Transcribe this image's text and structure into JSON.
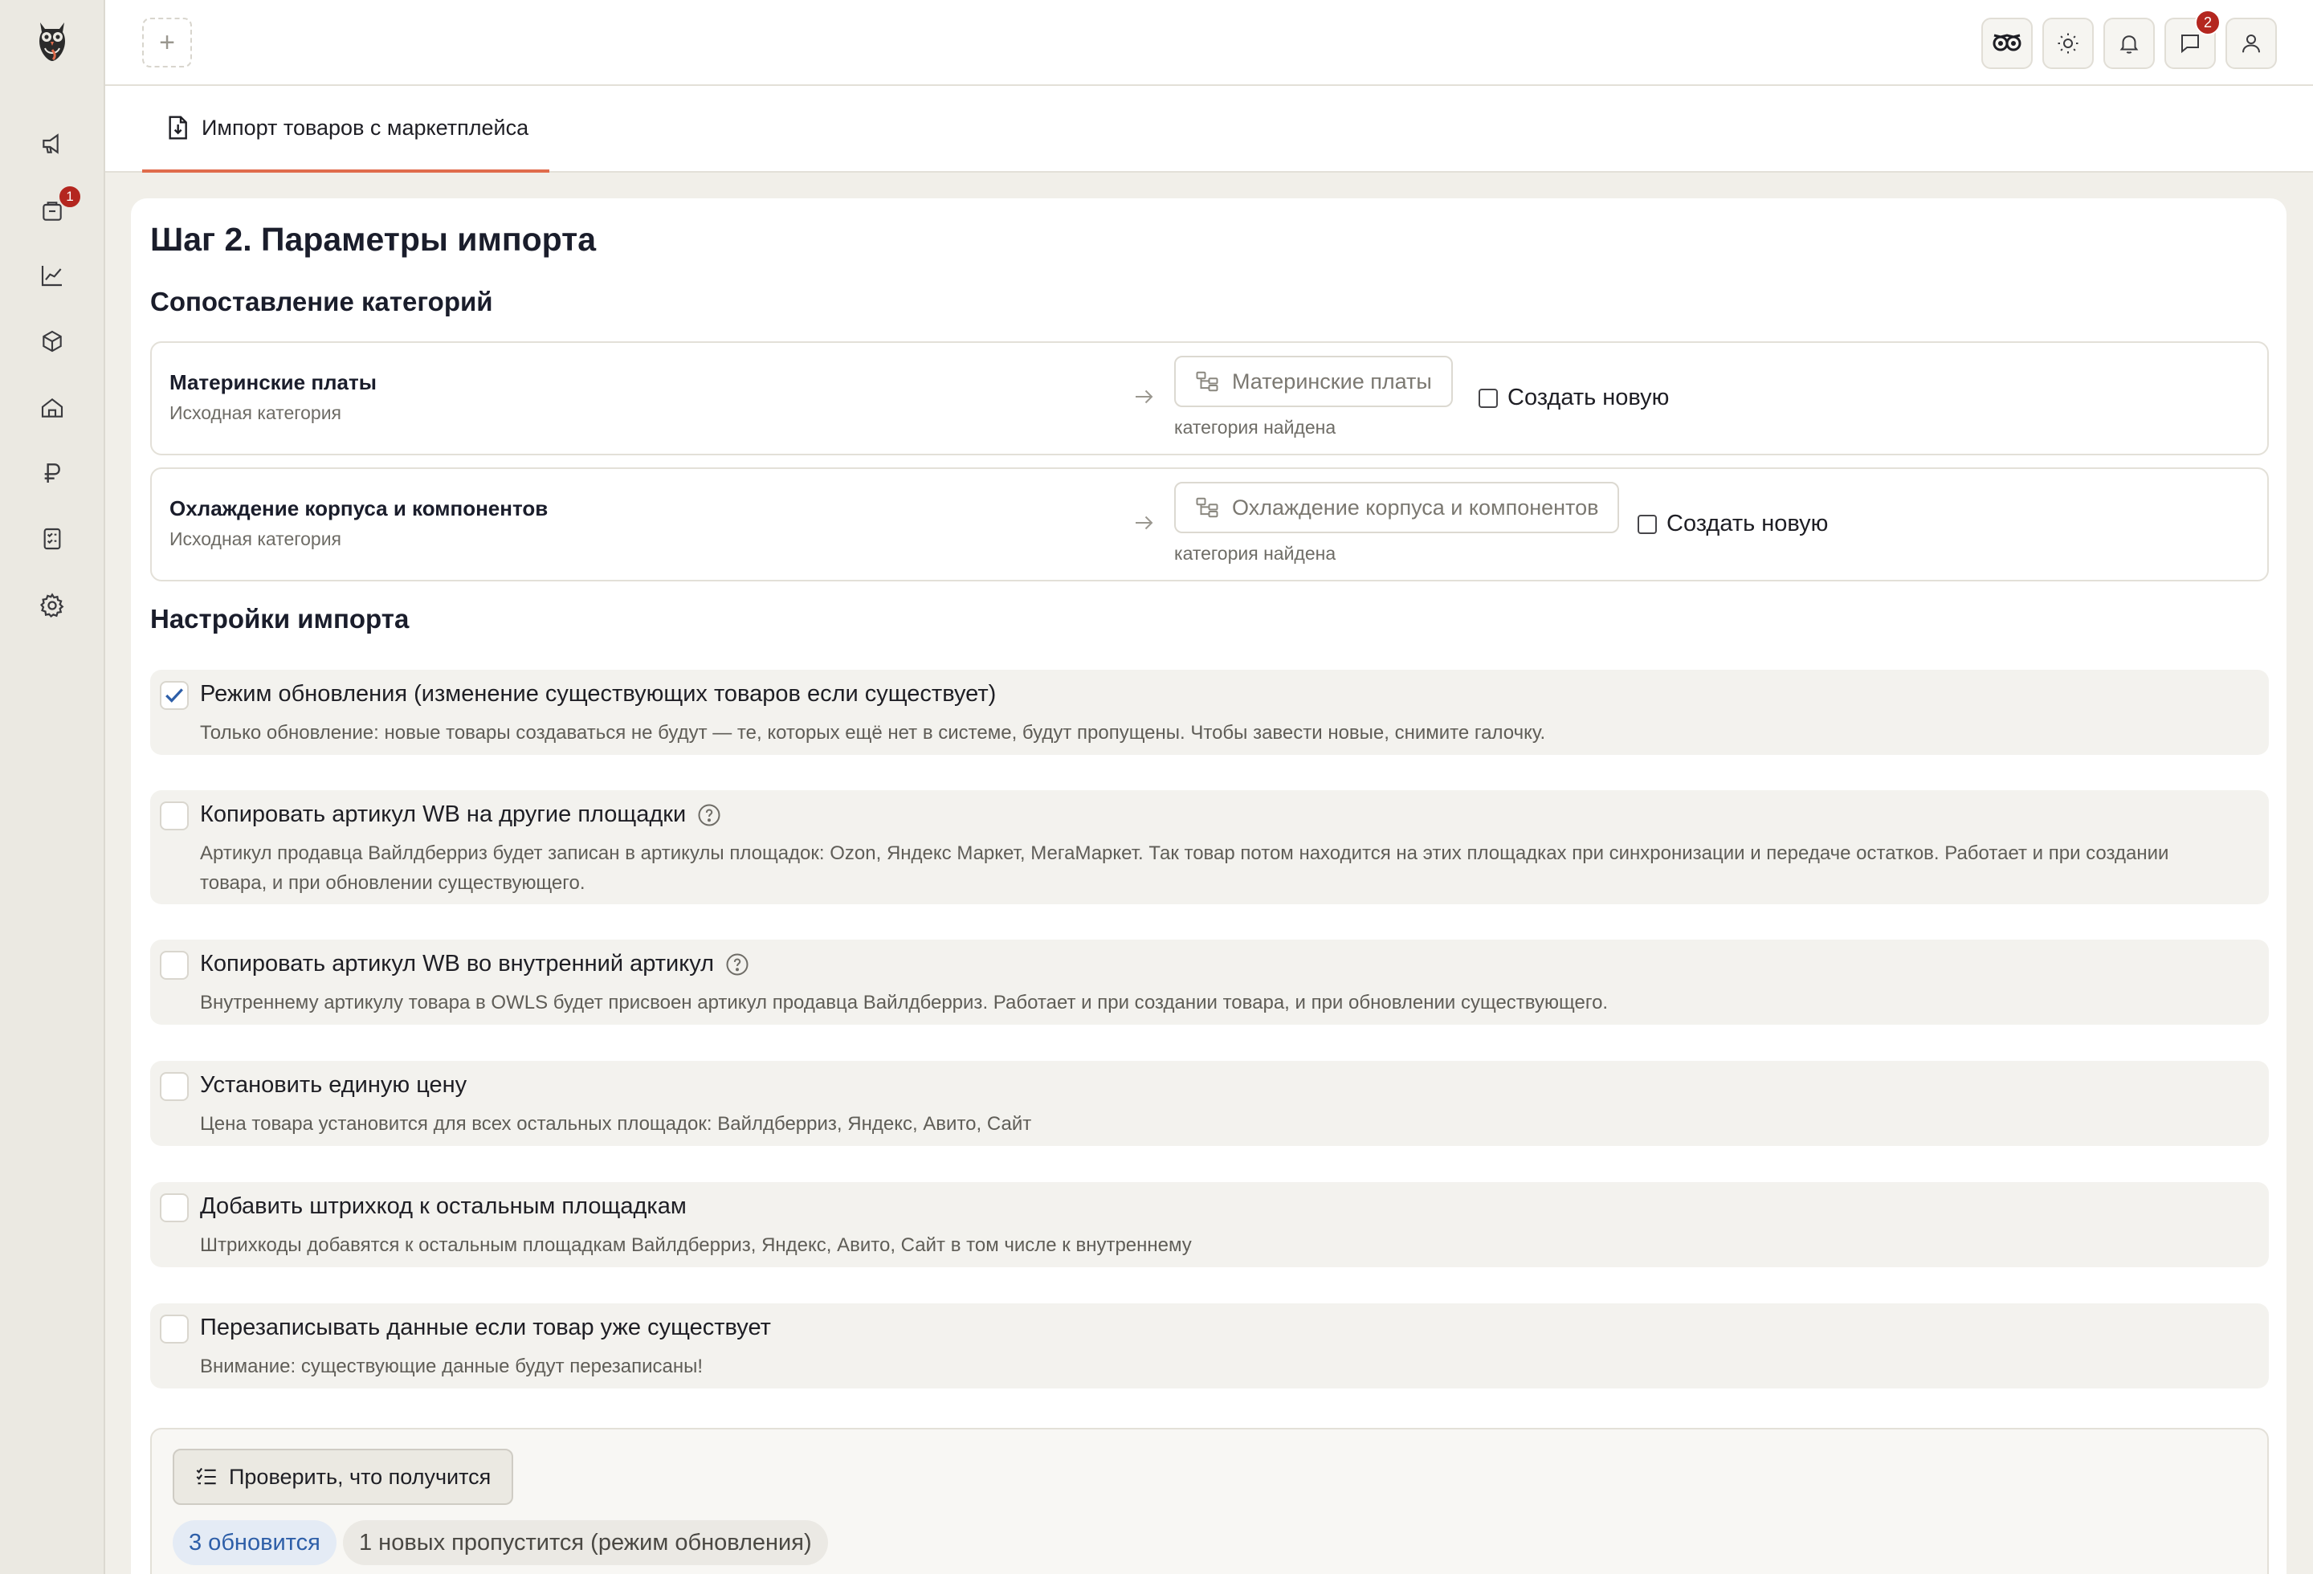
{
  "sidebar": {
    "logo_name": "owl-logo",
    "items": [
      {
        "name": "megaphone-icon"
      },
      {
        "name": "orders-icon",
        "badge": "1"
      },
      {
        "name": "analytics-icon"
      },
      {
        "name": "cube-icon"
      },
      {
        "name": "home-icon"
      },
      {
        "name": "ruble-icon"
      },
      {
        "name": "checklist-icon"
      },
      {
        "name": "settings-icon"
      }
    ]
  },
  "topbar": {
    "add_tab_label": "+",
    "messages_badge": "2"
  },
  "tab": {
    "label": "Импорт товаров с маркетплейса"
  },
  "page": {
    "title": "Шаг 2. Параметры импорта",
    "mapping_heading": "Сопоставление категорий",
    "settings_heading": "Настройки импорта"
  },
  "mappings": [
    {
      "source": "Материнские платы",
      "source_sub": "Исходная категория",
      "target": "Материнские платы",
      "status": "категория найдена",
      "create_label": "Создать новую"
    },
    {
      "source": "Охлаждение корпуса и компонентов",
      "source_sub": "Исходная категория",
      "target": "Охлаждение корпуса и компонентов",
      "status": "категория найдена",
      "create_label": "Создать новую"
    }
  ],
  "options": [
    {
      "title": "Режим обновления (изменение существующих товаров если существует)",
      "desc": "Только обновление: новые товары создаваться не будут — те, которых ещё нет в системе, будут пропущены. Чтобы завести новые, снимите галочку.",
      "checked": true
    },
    {
      "title": "Копировать артикул WB на другие площадки",
      "desc": "Артикул продавца Вайлдберриз будет записан в артикулы площадок: Ozon, Яндекс Маркет, МегаМаркет. Так товар потом находится на этих площадках при синхронизации и передаче остатков. Работает и при создании товара, и при обновлении существующего.",
      "checked": false,
      "help": true
    },
    {
      "title": "Копировать артикул WB во внутренний артикул",
      "desc": "Внутреннему артикулу товара в OWLS будет присвоен артикул продавца Вайлдберриз. Работает и при создании товара, и при обновлении существующего.",
      "checked": false,
      "help": true
    },
    {
      "title": "Установить единую цену",
      "desc": "Цена товара установится для всех остальных площадок: Вайлдберриз, Яндекс, Авито, Сайт",
      "checked": false
    },
    {
      "title": "Добавить штрихкод к остальным площадкам",
      "desc": "Штрихкоды добавятся к остальным площадкам Вайлдберриз, Яндекс, Авито, Сайт в том числе к внутреннему",
      "checked": false
    },
    {
      "title": "Перезаписывать данные если товар уже существует",
      "desc": "Внимание: существующие данные будут перезаписаны!",
      "checked": false
    }
  ],
  "result": {
    "check_button": "Проверить, что получится",
    "updated": "3 обновится",
    "skipped": "1 новых пропустится (режим обновления)"
  },
  "colors": {
    "accent": "#e06c4c",
    "badge": "#b4261f",
    "checkmark": "#2d5ea8"
  }
}
